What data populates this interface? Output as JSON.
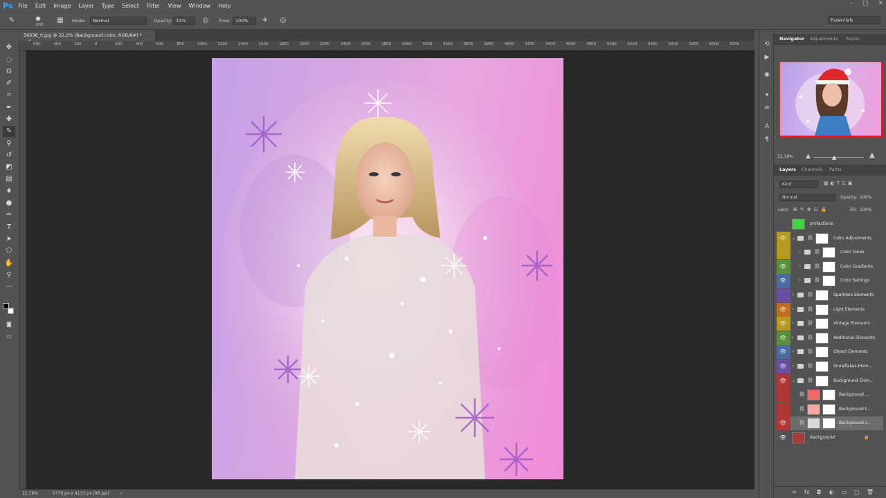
{
  "app": {
    "logo": "Ps"
  },
  "menu": [
    "File",
    "Edit",
    "Image",
    "Layer",
    "Type",
    "Select",
    "Filter",
    "View",
    "Window",
    "Help"
  ],
  "window_controls": [
    "–",
    "□",
    "✕"
  ],
  "options": {
    "brush_size": "800",
    "mode_label": "Mode:",
    "mode_value": "Normal",
    "opacity_label": "Opacity:",
    "opacity_value": "31%",
    "flow_label": "Flow:",
    "flow_value": "100%",
    "workspace": "Essentials"
  },
  "document": {
    "tab_title": "56938_0.jpg @ 22,2% (Background color, RGB/8#) *",
    "close": "×"
  },
  "ruler_ticks": [
    "600",
    "400",
    "200",
    "0",
    "200",
    "400",
    "600",
    "800",
    "1000",
    "1200",
    "1400",
    "1600",
    "1800",
    "2000",
    "2200",
    "2400",
    "2600",
    "2800",
    "3000",
    "3200",
    "3400",
    "3600",
    "3800",
    "4000",
    "4200",
    "4400",
    "4600",
    "4800",
    "5000",
    "5200",
    "5400",
    "5600",
    "5800",
    "6000",
    "6200"
  ],
  "status": {
    "zoom": "22,18%",
    "doc_size": "5776 px x 4133 px (96 ppi)",
    "arrow": "›"
  },
  "navigator": {
    "tabs": [
      "Navigator",
      "Adjustments",
      "Styles"
    ],
    "zoom": "22,18%"
  },
  "layers_panel": {
    "tabs": [
      "Layers",
      "Channels",
      "Paths"
    ],
    "filter_label": "Kind",
    "blend_mode": "Normal",
    "opacity_label": "Opacity:",
    "opacity_value": "100%",
    "lock_label": "Lock:",
    "fill_label": "Fill:",
    "fill_value": "100%",
    "layers": [
      {
        "name": "profactions",
        "color": "",
        "visible": false,
        "indent": 0,
        "type": "layer",
        "thumb": "#3ed63e",
        "expand": ""
      },
      {
        "name": "Color Adjustments",
        "color": "#b59a1f",
        "visible": true,
        "indent": 0,
        "type": "group",
        "thumb": "#ffffff",
        "expand": "⌄"
      },
      {
        "name": "Color Tones",
        "color": "#b59a1f",
        "visible": false,
        "indent": 1,
        "type": "group",
        "thumb": "#ffffff",
        "expand": "›"
      },
      {
        "name": "Color Gradients",
        "color": "#5b8f3e",
        "visible": true,
        "indent": 1,
        "type": "group",
        "thumb": "#ffffff",
        "expand": "›"
      },
      {
        "name": "Color Settings",
        "color": "#4a6aa3",
        "visible": true,
        "indent": 1,
        "type": "group",
        "thumb": "#ffffff",
        "expand": "›"
      },
      {
        "name": "Sparklers Elements",
        "color": "#6a4fa0",
        "visible": false,
        "indent": 0,
        "type": "group",
        "thumb": "#ffffff",
        "expand": "›"
      },
      {
        "name": "Light Elements",
        "color": "#c0701c",
        "visible": true,
        "indent": 0,
        "type": "group",
        "thumb": "#ffffff",
        "expand": "›"
      },
      {
        "name": "Vintage Elements",
        "color": "#b59a1f",
        "visible": true,
        "indent": 0,
        "type": "group",
        "thumb": "#ffffff",
        "expand": "›"
      },
      {
        "name": "Additional Elements",
        "color": "#5b8f3e",
        "visible": true,
        "indent": 0,
        "type": "group",
        "thumb": "#ffffff",
        "expand": "›"
      },
      {
        "name": "Object Elements",
        "color": "#4a6aa3",
        "visible": true,
        "indent": 0,
        "type": "group",
        "thumb": "#ffffff",
        "expand": "›"
      },
      {
        "name": "Snowflakes Elem...",
        "color": "#6a4fa0",
        "visible": true,
        "indent": 0,
        "type": "group",
        "thumb": "#ffffff",
        "expand": "›"
      },
      {
        "name": "Background Elem...",
        "color": "#b53535",
        "visible": true,
        "indent": 0,
        "type": "group",
        "thumb": "#ffffff",
        "expand": "⌄"
      },
      {
        "name": "Background ...",
        "color": "#b53535",
        "visible": false,
        "indent": 1,
        "type": "layer",
        "thumb": "#f06a6a",
        "expand": ""
      },
      {
        "name": "Background t...",
        "color": "#b53535",
        "visible": false,
        "indent": 1,
        "type": "layer",
        "thumb": "#f6a8a0",
        "expand": ""
      },
      {
        "name": "Background c...",
        "color": "#b53535",
        "visible": true,
        "indent": 1,
        "type": "layer",
        "thumb": "#d9d9d9",
        "expand": "",
        "selected": true
      },
      {
        "name": "Background",
        "color": "",
        "visible": true,
        "indent": 0,
        "type": "locked",
        "thumb": "#a83a3a",
        "expand": "",
        "locked": "🔒"
      }
    ],
    "footer_icons": [
      "∞",
      "fx",
      "◘",
      "◐",
      "▭",
      "□",
      "🗑"
    ]
  }
}
